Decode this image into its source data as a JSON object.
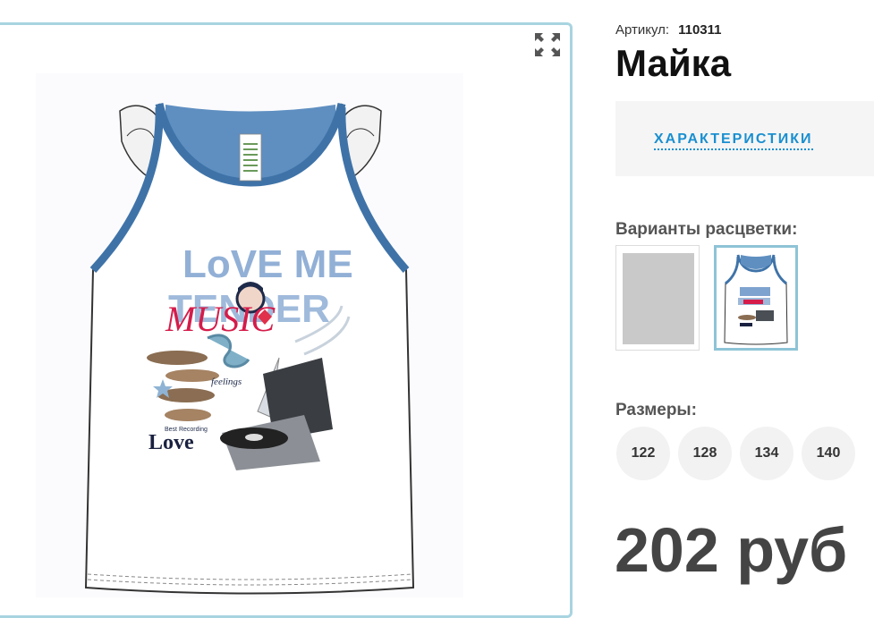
{
  "product": {
    "article_label": "Артикул:",
    "article_value": "110311",
    "title": "Майка",
    "price": "202 руб"
  },
  "tabs": {
    "characteristics": "ХАРАКТЕРИСТИКИ"
  },
  "variants": {
    "label": "Варианты расцветки:"
  },
  "sizes": {
    "label": "Размеры:",
    "options": [
      "122",
      "128",
      "134",
      "140"
    ]
  },
  "print": {
    "line1": "LoVE ME",
    "line2": "TENDER",
    "script": "MUSIC",
    "small": "feelings",
    "caption": "Best Recording",
    "brand": "Love"
  },
  "icons": {
    "fullscreen": "expand-arrows-icon"
  },
  "colors": {
    "accent_blue": "#1a8fd0",
    "frame_border": "#a8d4e0",
    "selected_swatch_border": "#8ec3d6",
    "trim_blue": "#3f73a8"
  }
}
